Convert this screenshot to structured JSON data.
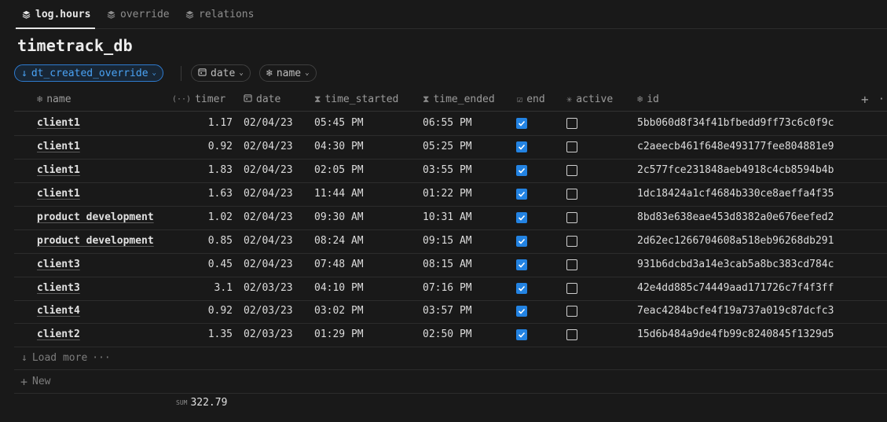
{
  "tabs": [
    {
      "label": "log.hours",
      "active": true
    },
    {
      "label": "override",
      "active": false
    },
    {
      "label": "relations",
      "active": false
    }
  ],
  "title": "timetrack_db",
  "filters": {
    "sort": {
      "label": "dt_created_override",
      "icon": "arrow-down-icon"
    },
    "date": {
      "label": "date"
    },
    "name": {
      "label": "name"
    }
  },
  "columns": [
    {
      "label": "name",
      "icon": "snowflake-icon"
    },
    {
      "label": "timer",
      "icon": "formula-icon"
    },
    {
      "label": "date",
      "icon": "calendar-icon"
    },
    {
      "label": "time_started",
      "icon": "hourglass-icon"
    },
    {
      "label": "time_ended",
      "icon": "hourglass-icon"
    },
    {
      "label": "end",
      "icon": "checkbox-icon"
    },
    {
      "label": "active",
      "icon": "asterisk-icon"
    },
    {
      "label": "id",
      "icon": "snowflake-icon"
    }
  ],
  "header_actions": {
    "add": "+",
    "more": "···"
  },
  "rows": [
    {
      "name": "client1",
      "timer": "1.17",
      "date": "02/04/23",
      "time_started": "05:45 PM",
      "time_ended": "06:55 PM",
      "end": true,
      "active": false,
      "id": "5bb060d8f34f41bfbedd9ff73c6c0f9c"
    },
    {
      "name": "client1",
      "timer": "0.92",
      "date": "02/04/23",
      "time_started": "04:30 PM",
      "time_ended": "05:25 PM",
      "end": true,
      "active": false,
      "id": "c2aeecb461f648e493177fee804881e9"
    },
    {
      "name": "client1",
      "timer": "1.83",
      "date": "02/04/23",
      "time_started": "02:05 PM",
      "time_ended": "03:55 PM",
      "end": true,
      "active": false,
      "id": "2c577fce231848aeb4918c4cb8594b4b"
    },
    {
      "name": "client1",
      "timer": "1.63",
      "date": "02/04/23",
      "time_started": "11:44 AM",
      "time_ended": "01:22 PM",
      "end": true,
      "active": false,
      "id": "1dc18424a1cf4684b330ce8aeffa4f35"
    },
    {
      "name": "product development",
      "timer": "1.02",
      "date": "02/04/23",
      "time_started": "09:30 AM",
      "time_ended": "10:31 AM",
      "end": true,
      "active": false,
      "id": "8bd83e638eae453d8382a0e676eefed2"
    },
    {
      "name": "product development",
      "timer": "0.85",
      "date": "02/04/23",
      "time_started": "08:24 AM",
      "time_ended": "09:15 AM",
      "end": true,
      "active": false,
      "id": "2d62ec1266704608a518eb96268db291"
    },
    {
      "name": "client3",
      "timer": "0.45",
      "date": "02/04/23",
      "time_started": "07:48 AM",
      "time_ended": "08:15 AM",
      "end": true,
      "active": false,
      "id": "931b6dcbd3a14e3cab5a8bc383cd784c"
    },
    {
      "name": "client3",
      "timer": "3.1",
      "date": "02/03/23",
      "time_started": "04:10 PM",
      "time_ended": "07:16 PM",
      "end": true,
      "active": false,
      "id": "42e4dd885c74449aad171726c7f4f3ff"
    },
    {
      "name": "client4",
      "timer": "0.92",
      "date": "02/03/23",
      "time_started": "03:02 PM",
      "time_ended": "03:57 PM",
      "end": true,
      "active": false,
      "id": "7eac4284bcfe4f19a737a019c87dcfc3"
    },
    {
      "name": "client2",
      "timer": "1.35",
      "date": "02/03/23",
      "time_started": "01:29 PM",
      "time_ended": "02:50 PM",
      "end": true,
      "active": false,
      "id": "15d6b484a9de4fb99c8240845f1329d5"
    }
  ],
  "load_more": "Load more",
  "new_row": "New",
  "summary": {
    "label": "SUM",
    "value": "322.79"
  },
  "colors": {
    "background": "#191919",
    "accent": "#2383e2",
    "text": "#d4d4d4"
  }
}
